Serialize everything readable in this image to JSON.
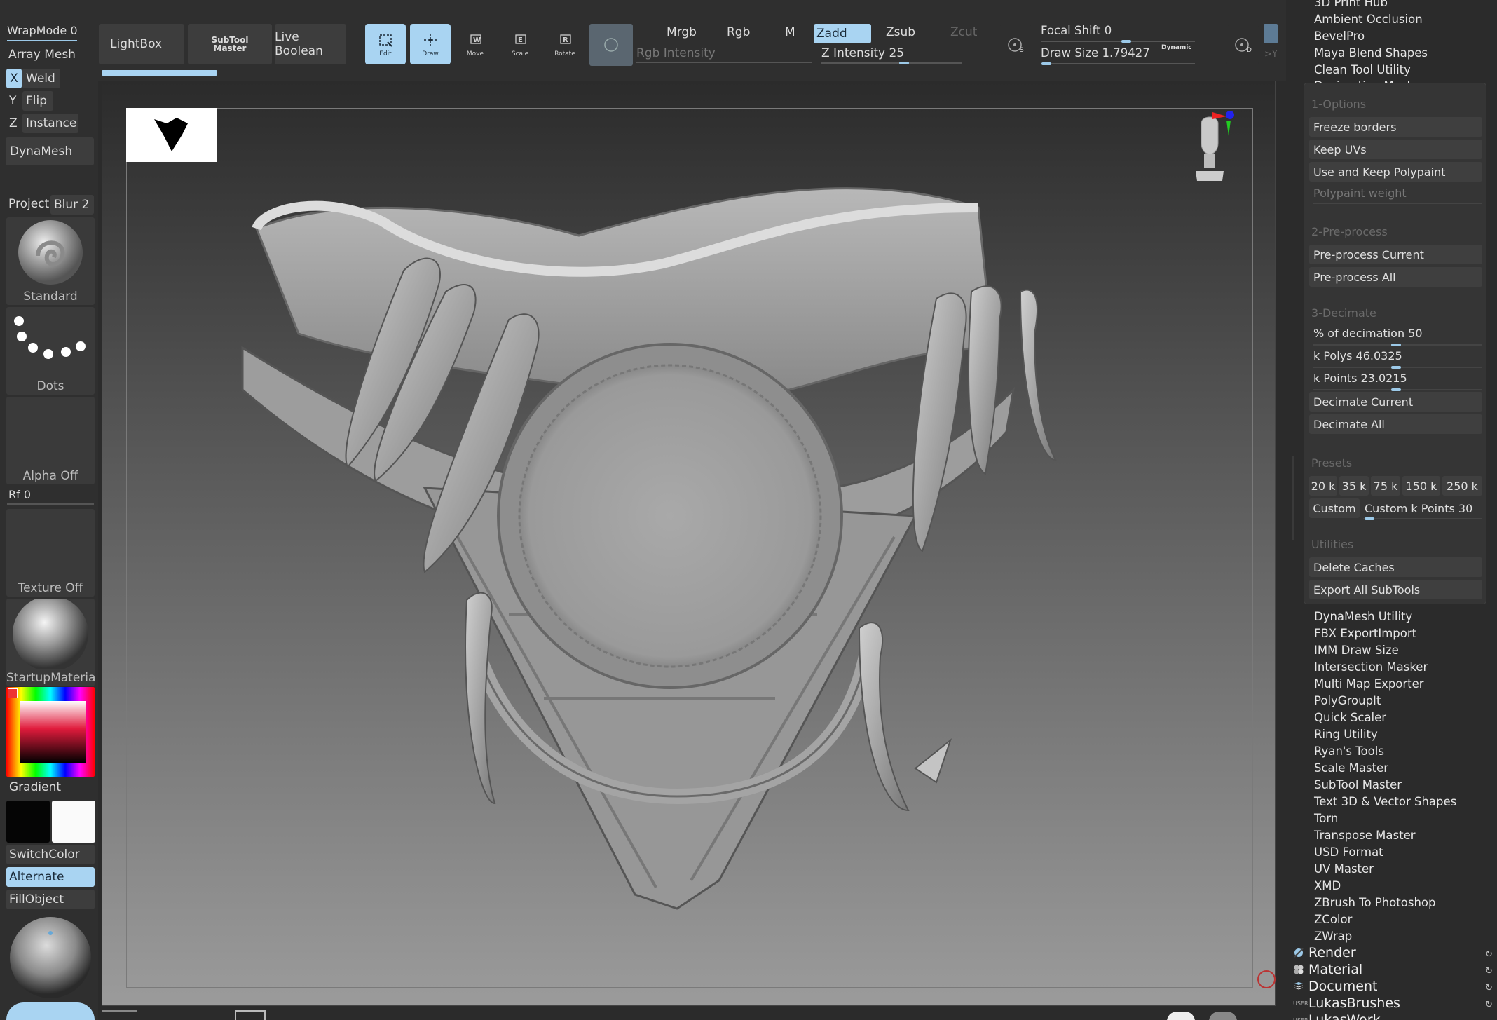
{
  "top": {
    "wrapmode": "WrapMode 0",
    "arraymesh": "Array Mesh",
    "lightbox": "LightBox",
    "subtool_master_line1": "SubTool",
    "subtool_master_line2": "Master",
    "live_boolean": "Live Boolean",
    "tools": [
      {
        "label": "Edit",
        "icon": "edit-icon",
        "selected": true
      },
      {
        "label": "Draw",
        "icon": "draw-icon",
        "selected": true
      },
      {
        "label": "Move",
        "icon": "move-icon",
        "selected": false
      },
      {
        "label": "Scale",
        "icon": "scale-icon",
        "selected": false
      },
      {
        "label": "Rotate",
        "icon": "rotate-icon",
        "selected": false
      }
    ],
    "mrgb": "Mrgb",
    "rgb": "Rgb",
    "m": "M",
    "zadd": "Zadd",
    "zsub": "Zsub",
    "zcut": "Zcut",
    "rgb_intensity": "Rgb Intensity",
    "z_intensity": "Z Intensity 25",
    "focal_shift": "Focal Shift 0",
    "draw_size": "Draw Size 1.79427",
    "dynamic": "Dynamic",
    "z_intensity_value": 25,
    "draw_size_value": 1.79427
  },
  "left": {
    "x_label": "X",
    "weld": "Weld",
    "y_label": "Y",
    "flip": "Flip",
    "z_label": "Z",
    "instance": "Instance",
    "dynamesh": "DynaMesh",
    "project": "Project",
    "blur": "Blur 2",
    "brush_name": "Standard",
    "stroke_name": "Dots",
    "alpha_name": "Alpha Off",
    "rf": "Rf 0",
    "texture_name": "Texture Off",
    "material_name": "StartupMaterial",
    "gradient": "Gradient",
    "switchcolor": "SwitchColor",
    "alternate": "Alternate",
    "fillobject": "FillObject"
  },
  "right": {
    "plugins_top": [
      "3D Print Hub",
      "Ambient Occlusion",
      "BevelPro",
      "Maya Blend Shapes",
      "Clean Tool Utility",
      "Decimation Master"
    ],
    "decimation": {
      "opt_header": "1-Options",
      "freeze_borders": "Freeze borders",
      "keep_uvs": "Keep UVs",
      "use_polypaint": "Use and Keep Polypaint",
      "polypaint_weight": "Polypaint weight",
      "pre_header": "2-Pre-process",
      "preprocess_current": "Pre-process Current",
      "preprocess_all": "Pre-process All",
      "dec_header": "3-Decimate",
      "percent": "% of decimation 50",
      "kpolys": "k Polys 46.0325",
      "kpoints": "k Points 23.0215",
      "decimate_current": "Decimate Current",
      "decimate_all": "Decimate All",
      "presets_header": "Presets",
      "presets": [
        "20 k",
        "35 k",
        "75 k",
        "150 k",
        "250 k"
      ],
      "custom": "Custom",
      "custom_kpoints": "Custom k Points 30",
      "util_header": "Utilities",
      "delete_caches": "Delete Caches",
      "export_all": "Export All SubTools"
    },
    "plugins_bottom": [
      "DynaMesh Utility",
      "FBX ExportImport",
      "IMM Draw Size",
      "Intersection Masker",
      "Multi Map Exporter",
      "PolyGroupIt",
      "Quick Scaler",
      "Ring Utility",
      "Ryan's Tools",
      "Scale Master",
      "SubTool Master",
      "Text 3D & Vector Shapes",
      "Torn",
      "Transpose Master",
      "USD Format",
      "UV Master",
      "XMD",
      "ZBrush To Photoshop",
      "ZColor",
      "ZWrap"
    ],
    "menus": [
      {
        "label": "Render",
        "icon": "render-icon"
      },
      {
        "label": "Material",
        "icon": "material-icon"
      },
      {
        "label": "Document",
        "icon": "document-icon"
      },
      {
        "label": "LukasBrushes",
        "icon": "user-icon"
      },
      {
        "label": "LukasWork",
        "icon": "user-icon"
      }
    ],
    "user_tag": "USER"
  },
  "colors": {
    "accent": "#a9d4f2",
    "panel": "#2f2f2f",
    "button": "#3d3d3d"
  }
}
